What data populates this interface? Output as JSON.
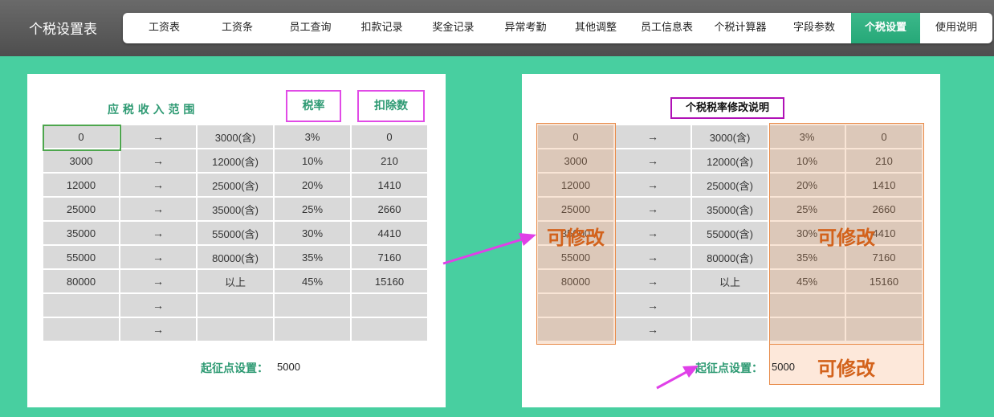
{
  "app": {
    "title": "个税设置表"
  },
  "nav": {
    "items": [
      "工资表",
      "工资条",
      "员工查询",
      "扣款记录",
      "奖金记录",
      "异常考勤",
      "其他调整",
      "员工信息表",
      "个税计算器",
      "字段参数",
      "个税设置",
      "使用说明"
    ],
    "active": "个税设置"
  },
  "left_panel": {
    "income_range_header": "应 税 收 入 范 围",
    "rate_header": "税率",
    "deduction_header": "扣除数",
    "rows": [
      [
        "0",
        "→",
        "3000(含)",
        "3%",
        "0"
      ],
      [
        "3000",
        "→",
        "12000(含)",
        "10%",
        "210"
      ],
      [
        "12000",
        "→",
        "25000(含)",
        "20%",
        "1410"
      ],
      [
        "25000",
        "→",
        "35000(含)",
        "25%",
        "2660"
      ],
      [
        "35000",
        "→",
        "55000(含)",
        "30%",
        "4410"
      ],
      [
        "55000",
        "→",
        "80000(含)",
        "35%",
        "7160"
      ],
      [
        "80000",
        "→",
        "以上",
        "45%",
        "15160"
      ],
      [
        "",
        "→",
        "",
        "",
        ""
      ],
      [
        "",
        "→",
        "",
        "",
        ""
      ]
    ],
    "threshold_label": "起征点设置：",
    "threshold_value": "5000"
  },
  "right_panel": {
    "title": "个税税率修改说明",
    "rows": [
      [
        "0",
        "→",
        "3000(含)",
        "3%",
        "0"
      ],
      [
        "3000",
        "→",
        "12000(含)",
        "10%",
        "210"
      ],
      [
        "12000",
        "→",
        "25000(含)",
        "20%",
        "1410"
      ],
      [
        "25000",
        "→",
        "35000(含)",
        "25%",
        "2660"
      ],
      [
        "35000",
        "→",
        "55000(含)",
        "30%",
        "4410"
      ],
      [
        "55000",
        "→",
        "80000(含)",
        "35%",
        "7160"
      ],
      [
        "80000",
        "→",
        "以上",
        "45%",
        "15160"
      ],
      [
        "",
        "→",
        "",
        "",
        ""
      ],
      [
        "",
        "→",
        "",
        "",
        ""
      ]
    ],
    "threshold_label": "起征点设置：",
    "threshold_value": "5000",
    "editable_label": "可修改"
  },
  "colors": {
    "background": "#48cfa0",
    "accent": "#2e9a73",
    "highlight_box": "#e14be6",
    "annotation": "#d3621b",
    "arrow": "#e040e8"
  }
}
